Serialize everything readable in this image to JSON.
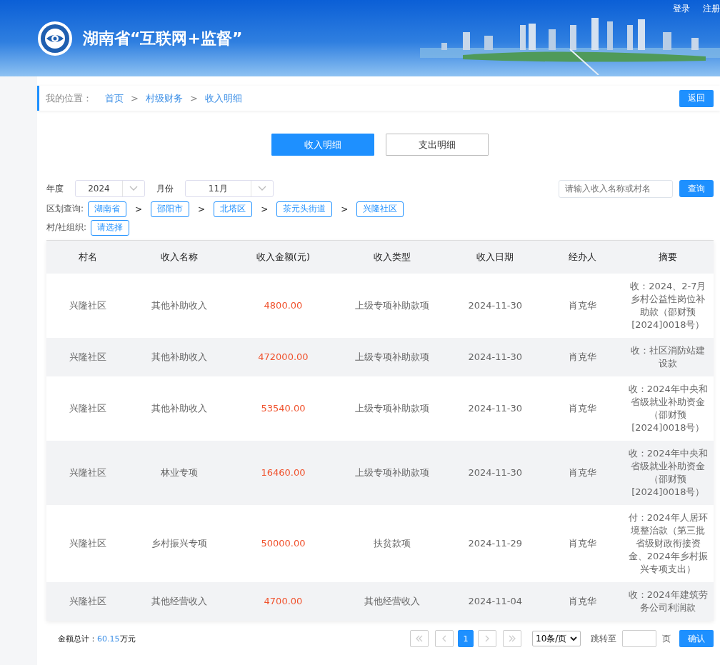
{
  "header": {
    "title": "湖南省“互联网+监督”",
    "links": [
      "登录",
      "注册"
    ]
  },
  "breadcrumb": {
    "label": "我的位置：",
    "items": [
      {
        "label": "首页",
        "after": ">"
      },
      {
        "label": "村级财务",
        "after": ">"
      },
      {
        "label": "收入明细"
      }
    ],
    "back": "返回"
  },
  "tabs": [
    {
      "label": "收入明细",
      "selected": true
    },
    {
      "label": "支出明细",
      "selected": false
    }
  ],
  "filters": {
    "year_label": "年度",
    "year": "2024",
    "month_label": "月份",
    "month": "11月",
    "search_placeholder": "请输入收入名称或村名",
    "search_button": "查询",
    "region_label": "区划查询:",
    "regions": [
      {
        "label": "湖南省",
        "after": ">"
      },
      {
        "label": "邵阳市",
        "after": ">"
      },
      {
        "label": "北塔区",
        "after": ">"
      },
      {
        "label": "茶元头街道",
        "after": ">"
      },
      {
        "label": "兴隆社区"
      }
    ],
    "org_label": "村/社组织:",
    "org_button": "请选择"
  },
  "table": {
    "columns": [
      "村名",
      "收入名称",
      "收入金额(元)",
      "收入类型",
      "收入日期",
      "经办人",
      "摘要"
    ],
    "rows": [
      [
        "兴隆社区",
        "其他补助收入",
        "4800.00",
        "上级专项补助款项",
        "2024-11-30",
        "肖克华",
        "收：2024、2-7月乡村公益性岗位补助款（邵财预[2024]0018号）"
      ],
      [
        "兴隆社区",
        "其他补助收入",
        "472000.00",
        "上级专项补助款项",
        "2024-11-30",
        "肖克华",
        "收：社区消防站建设款"
      ],
      [
        "兴隆社区",
        "其他补助收入",
        "53540.00",
        "上级专项补助款项",
        "2024-11-30",
        "肖克华",
        "收：2024年中央和省级就业补助资金（邵财预[2024]0018号）"
      ],
      [
        "兴隆社区",
        "林业专项",
        "16460.00",
        "上级专项补助款项",
        "2024-11-30",
        "肖克华",
        "收：2024年中央和省级就业补助资金（邵财预[2024]0018号）"
      ],
      [
        "兴隆社区",
        "乡村振兴专项",
        "50000.00",
        "扶贫款项",
        "2024-11-29",
        "肖克华",
        "付：2024年人居环境整治款（第三批省级财政衔接资金、2024年乡村振兴专项支出）"
      ],
      [
        "兴隆社区",
        "其他经营收入",
        "4700.00",
        "其他经营收入",
        "2024-11-04",
        "肖克华",
        "收：2024年建筑劳务公司利润款"
      ]
    ]
  },
  "footer": {
    "total_label": "金额总计：",
    "total_value": "60.15",
    "total_unit": "万元",
    "pages": [
      {
        "label": "1",
        "selected": true
      }
    ],
    "page_size": "10条/页",
    "jump_label": "跳转至",
    "page_unit": "页",
    "confirm": "确认"
  }
}
